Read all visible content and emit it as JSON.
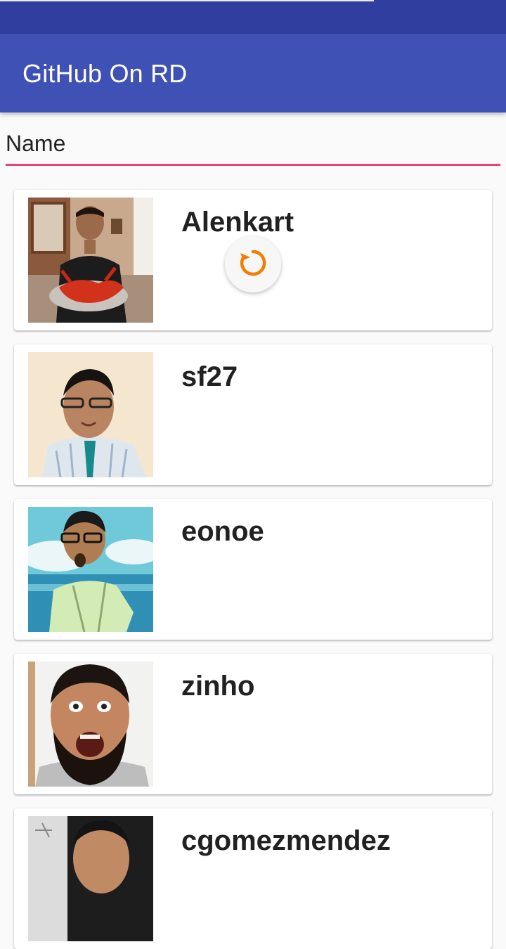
{
  "app": {
    "title": "GitHub On RD",
    "primary_color": "#3f51b5",
    "status_bar_color": "#303f9f",
    "accent_color": "#ec407a"
  },
  "search": {
    "placeholder": "Name",
    "value": ""
  },
  "loading": {
    "icon": "refresh-icon",
    "color": "#f57c00"
  },
  "users": [
    {
      "login": "Alenkart"
    },
    {
      "login": "sf27"
    },
    {
      "login": "eonoe"
    },
    {
      "login": "zinho"
    },
    {
      "login": "cgomezmendez"
    }
  ]
}
